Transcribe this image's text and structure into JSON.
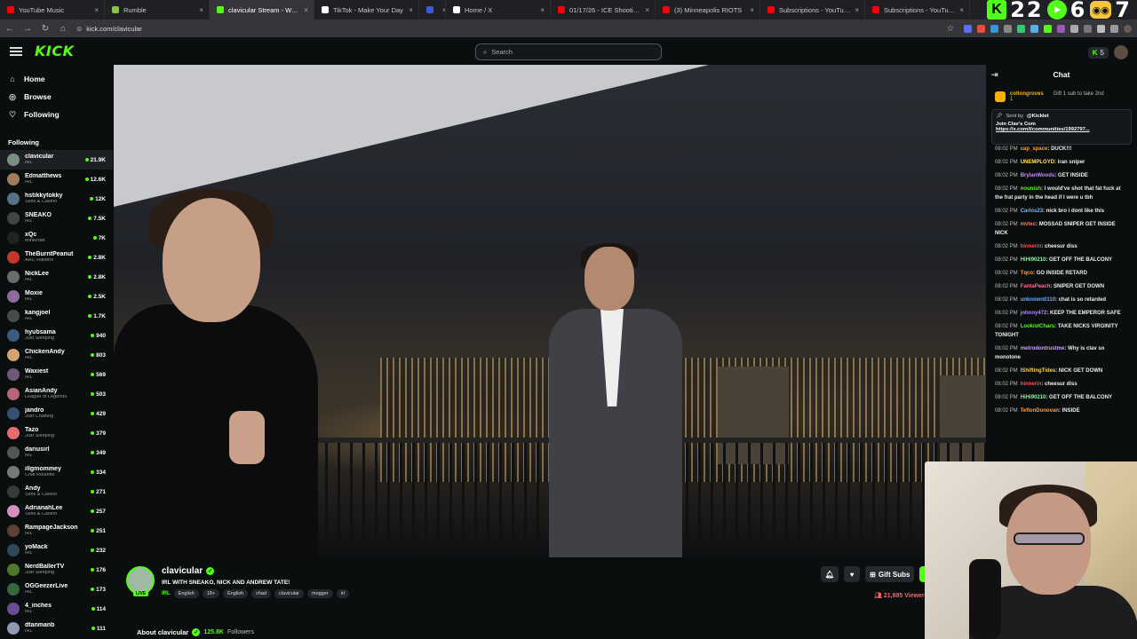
{
  "browser": {
    "tabs": [
      {
        "title": "YouTube Music",
        "color": "#ff0000",
        "active": false
      },
      {
        "title": "Rumble",
        "color": "#85c742",
        "active": false
      },
      {
        "title": "clavicular Stream - Watch L",
        "color": "#53fc18",
        "active": true
      },
      {
        "title": "TikTok - Make Your Day",
        "color": "#ffffff",
        "active": false
      },
      {
        "title": "",
        "color": "#3b5bdb",
        "active": false
      },
      {
        "title": "Home / X",
        "color": "#ffffff",
        "active": false
      },
      {
        "title": "01/17/26 - ICE Shooting Protes",
        "color": "#ff0000",
        "active": false
      },
      {
        "title": "(3) Minneapolis RIOTS",
        "color": "#ff0000",
        "active": false
      },
      {
        "title": "Subscriptions - YouTube",
        "color": "#ff0000",
        "active": false
      },
      {
        "title": "Subscriptions - YouTube",
        "color": "#ff0000",
        "active": false
      }
    ],
    "url": "kick.com/clavicular",
    "overlay_counter_1": "22",
    "overlay_counter_2": "6",
    "overlay_counter_3": "7"
  },
  "topnav": {
    "logo": "KICK",
    "search_placeholder": "Search",
    "kicks_count": "5"
  },
  "sidebar": {
    "nav": [
      {
        "label": "Home",
        "icon": "home-icon"
      },
      {
        "label": "Browse",
        "icon": "compass-icon"
      },
      {
        "label": "Following",
        "icon": "heart-icon"
      }
    ],
    "following_header": "Following",
    "channels": [
      {
        "name": "clavicular",
        "category": "IRL",
        "viewers": "21.9K",
        "color": "#7a8f83"
      },
      {
        "name": "Edmatthews",
        "category": "IRL",
        "viewers": "12.6K",
        "color": "#a07d5a"
      },
      {
        "name": "hstikkytokky",
        "category": "Slots & Casino",
        "viewers": "12K",
        "color": "#5a6f8a"
      },
      {
        "name": "SNEAKO",
        "category": "IRL",
        "viewers": "7.5K",
        "color": "#444444"
      },
      {
        "name": "xQc",
        "category": "Minecraft",
        "viewers": "7K",
        "color": "#222222"
      },
      {
        "name": "TheBurntPeanut",
        "category": "ARC Raiders",
        "viewers": "2.8K",
        "color": "#c0392b"
      },
      {
        "name": "NickLee",
        "category": "IRL",
        "viewers": "2.8K",
        "color": "#6b6b6b"
      },
      {
        "name": "Moxie",
        "category": "IRL",
        "viewers": "2.5K",
        "color": "#8e6b9a"
      },
      {
        "name": "kangjoel",
        "category": "IRL",
        "viewers": "1.7K",
        "color": "#4a4a4a"
      },
      {
        "name": "hyubsama",
        "category": "Just Sleeping",
        "viewers": "940",
        "color": "#3d5a80"
      },
      {
        "name": "ChickenAndy",
        "category": "IRL",
        "viewers": "803",
        "color": "#d4a373"
      },
      {
        "name": "Waxiest",
        "category": "IRL",
        "viewers": "569",
        "color": "#6d597a"
      },
      {
        "name": "AsianAndy",
        "category": "League of Legends",
        "viewers": "503",
        "color": "#b56576"
      },
      {
        "name": "jandro",
        "category": "Just Chatting",
        "viewers": "429",
        "color": "#355070"
      },
      {
        "name": "Tazo",
        "category": "Just Sleeping",
        "viewers": "379",
        "color": "#e56b6f"
      },
      {
        "name": "dariusirl",
        "category": "IRL",
        "viewers": "349",
        "color": "#555555"
      },
      {
        "name": "illgmommey",
        "category": "Chat Roulette",
        "viewers": "334",
        "color": "#777777"
      },
      {
        "name": "Andy",
        "category": "Slots & Casino",
        "viewers": "271",
        "color": "#3a3a3a"
      },
      {
        "name": "AdrianahLee",
        "category": "Slots & Casino",
        "viewers": "257",
        "color": "#d291bc"
      },
      {
        "name": "RampageJackson",
        "category": "IRL",
        "viewers": "251",
        "color": "#5c4033"
      },
      {
        "name": "yoMack",
        "category": "IRL",
        "viewers": "232",
        "color": "#2f4858"
      },
      {
        "name": "NerdBallerTV",
        "category": "Just Sleeping",
        "viewers": "176",
        "color": "#4f772d"
      },
      {
        "name": "OGGeezerLive",
        "category": "IRL",
        "viewers": "173",
        "color": "#386641"
      },
      {
        "name": "4_inches",
        "category": "IRL",
        "viewers": "114",
        "color": "#6a4c93"
      },
      {
        "name": "dtanmanb",
        "category": "IRL",
        "viewers": "111",
        "color": "#8d99ae"
      }
    ]
  },
  "stream": {
    "channel": "clavicular",
    "title": "IRL WITH SNEAKO, NICK AND ANDREW TATE!",
    "category": "IRL",
    "tags": [
      "English",
      "18+",
      "English",
      "chad",
      "clavicular",
      "mogger",
      "irl"
    ],
    "live_label": "LIVE",
    "gift_subs_label": "Gift Subs",
    "viewers": "21,885",
    "viewers_label": "Viewers",
    "about_label": "About clavicular",
    "followers_count": "125.8K",
    "followers_label": "Followers"
  },
  "chat": {
    "title": "Chat",
    "top_gifter": {
      "name": "coltongroves",
      "count": "1",
      "note": "Gift 1 sub to take 2nd"
    },
    "pinned": {
      "sent_by_label": "Sent by",
      "author": "@Kicklet",
      "text": "Join Clav's Com",
      "link": "https://x.com/i/communities/1992797..."
    },
    "messages": [
      {
        "time": "08:02 PM",
        "user": "cap_space",
        "color": "#f2a541",
        "text": "DUCK!!!"
      },
      {
        "time": "08:02 PM",
        "user": "UNEMPLOYD",
        "color": "#ffe14d",
        "text": "iran sniper"
      },
      {
        "time": "08:02 PM",
        "user": "BrylanWoods",
        "color": "#c48bff",
        "text": "GET INSIDE"
      },
      {
        "time": "08:02 PM",
        "user": "nounish",
        "color": "#53fc18",
        "text": "I would've shot that fat fuck at the frat party in the head if I were u tbh"
      },
      {
        "time": "08:02 PM",
        "user": "Carlos23",
        "color": "#7ab8ff",
        "text": "nick bro i dont like this"
      },
      {
        "time": "08:02 PM",
        "user": "mvtec",
        "color": "#ff7a59",
        "text": "MOSSAD SNIPER GET INSIDE NICK"
      },
      {
        "time": "08:02 PM",
        "user": "hinnerin",
        "color": "#ff4d4d",
        "text": "cheesur diss"
      },
      {
        "time": "08:02 PM",
        "user": "HiHi90210",
        "color": "#8af2a0",
        "text": "GET OFF THE BALCONY"
      },
      {
        "time": "08:02 PM",
        "user": "Tqco",
        "color": "#ff9f43",
        "text": "GO INSIDE RETARD"
      },
      {
        "time": "08:02 PM",
        "user": "FantaPeach",
        "color": "#ff6b9e",
        "text": "SNIPER GET DOWN"
      },
      {
        "time": "08:02 PM",
        "user": "unknown0110",
        "color": "#6fa8ff",
        "text": "chat is so retarded"
      },
      {
        "time": "08:02 PM",
        "user": "johnny472",
        "color": "#b388ff",
        "text": "KEEP THE EMPEROR SAFE"
      },
      {
        "time": "08:02 PM",
        "user": "LookistChars",
        "color": "#53fc18",
        "text": "TAKE NICKS VIRGINITY TONIGHT"
      },
      {
        "time": "08:02 PM",
        "user": "metrodontrustme",
        "color": "#d0a2ff",
        "text": "Why is clav so monotone"
      },
      {
        "time": "08:02 PM",
        "user": "IShiftingTides",
        "color": "#ffd24d",
        "text": "NICK GET DOWN"
      },
      {
        "time": "08:02 PM",
        "user": "hinnerin",
        "color": "#ff4d4d",
        "text": "cheesur diss"
      },
      {
        "time": "08:02 PM",
        "user": "HiHi90210",
        "color": "#8af2a0",
        "text": "GET OFF THE BALCONY"
      },
      {
        "time": "08:02 PM",
        "user": "TeflonDonovan",
        "color": "#ff9f43",
        "text": "INSIDE"
      }
    ]
  }
}
